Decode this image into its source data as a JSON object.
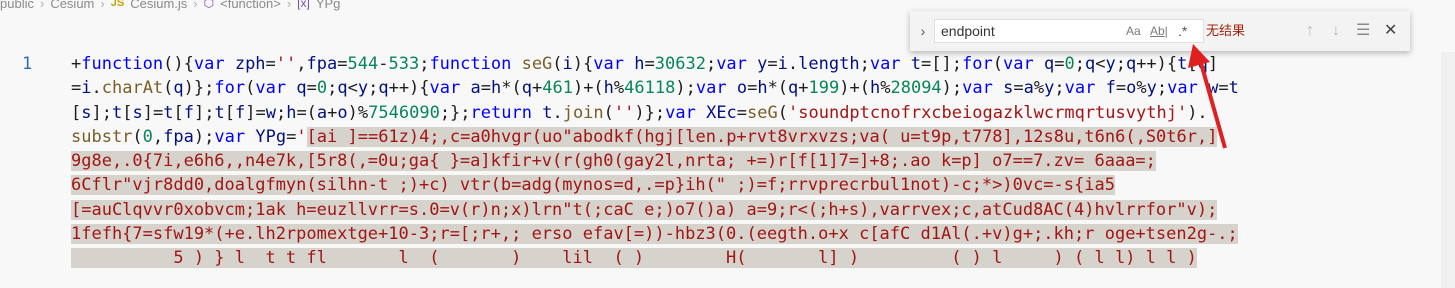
{
  "breadcrumb": {
    "items": [
      "public",
      "Cesium",
      "Cesium.js",
      "<function>",
      "YPg"
    ],
    "js_icon": "JS"
  },
  "editor": {
    "line_number": "1"
  },
  "find_widget": {
    "search_value": "endpoint",
    "match_case_label": "Aa",
    "whole_word_label": "Ab|",
    "regex_label": ".*",
    "result_text": "无结果",
    "prev_icon": "arrow-up-icon",
    "next_icon": "arrow-down-icon",
    "selection_icon": "find-in-selection-icon",
    "close_icon": "close-icon"
  },
  "colors": {
    "selection": "#d6d3cc",
    "keyword": "#0000ff",
    "identifier": "#001080",
    "string": "#a31515",
    "no_results": "#a1260d",
    "arrow": "#e02020"
  }
}
